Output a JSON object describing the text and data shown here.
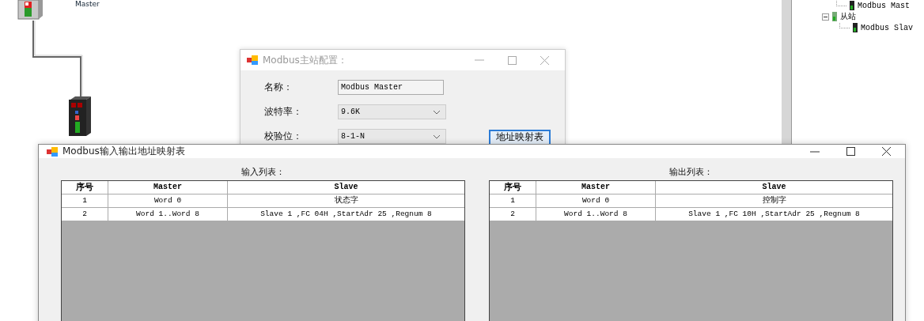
{
  "diagram": {
    "master_label": "Master"
  },
  "tree": {
    "items": [
      {
        "label": "Modbus Mast"
      },
      {
        "label": "从站",
        "expanded": true,
        "children": [
          {
            "label": "Modbus Slav"
          }
        ]
      }
    ]
  },
  "config_dialog": {
    "title": "Modbus主站配置：",
    "fields": [
      {
        "label": "名称：",
        "value": "Modbus Master",
        "kind": "text"
      },
      {
        "label": "波特率：",
        "value": "9.6K",
        "kind": "dropdown"
      },
      {
        "label": "校验位：",
        "value": "8-1-N",
        "kind": "dropdown"
      }
    ],
    "button": "地址映射表"
  },
  "map_window": {
    "title": "Modbus输入输出地址映射表",
    "tables": [
      {
        "caption": "输入列表：",
        "columns": [
          "序号",
          "Master",
          "Slave"
        ],
        "rows": [
          [
            "1",
            "Word 0",
            "状态字"
          ],
          [
            "2",
            "Word 1..Word 8",
            "Slave 1 ,FC 04H ,StartAdr 25 ,Regnum 8"
          ]
        ]
      },
      {
        "caption": "输出列表：",
        "columns": [
          "序号",
          "Master",
          "Slave"
        ],
        "rows": [
          [
            "1",
            "Word 0",
            "控制字"
          ],
          [
            "2",
            "Word 1..Word 8",
            "Slave 1 ,FC 10H ,StartAdr 25 ,Regnum 8"
          ]
        ]
      }
    ]
  }
}
